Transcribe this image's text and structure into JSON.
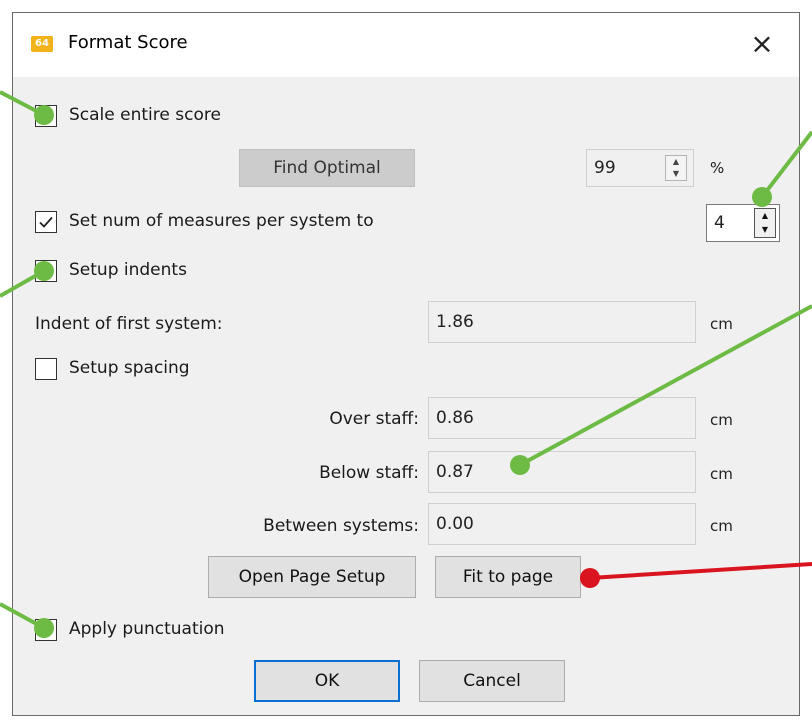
{
  "window": {
    "title": "Format Score",
    "icon_text": "64",
    "close_glyph": "×"
  },
  "scale": {
    "checkbox_label": "Scale entire score",
    "find_optimal_label": "Find Optimal",
    "value": "99",
    "unit": "%"
  },
  "measures": {
    "checkbox_label": "Set num of measures per system to",
    "value": "4"
  },
  "indents": {
    "checkbox_label": "Setup indents",
    "first_system_label": "Indent of first system:",
    "first_system_value": "1.86",
    "unit": "cm"
  },
  "spacing": {
    "checkbox_label": "Setup spacing",
    "over_staff_label": "Over staff:",
    "over_staff_value": "0.86",
    "below_staff_label": "Below staff:",
    "below_staff_value": "0.87",
    "between_systems_label": "Between systems:",
    "between_systems_value": "0.00",
    "unit": "cm"
  },
  "actions": {
    "open_page_setup_label": "Open Page Setup",
    "fit_to_page_label": "Fit to page"
  },
  "punctuation": {
    "checkbox_label": "Apply punctuation"
  },
  "footer": {
    "ok_label": "OK",
    "cancel_label": "Cancel"
  },
  "colors": {
    "callout_green": "#6dbb45",
    "callout_red": "#d9141e",
    "accent_blue": "#0a6fd1"
  }
}
